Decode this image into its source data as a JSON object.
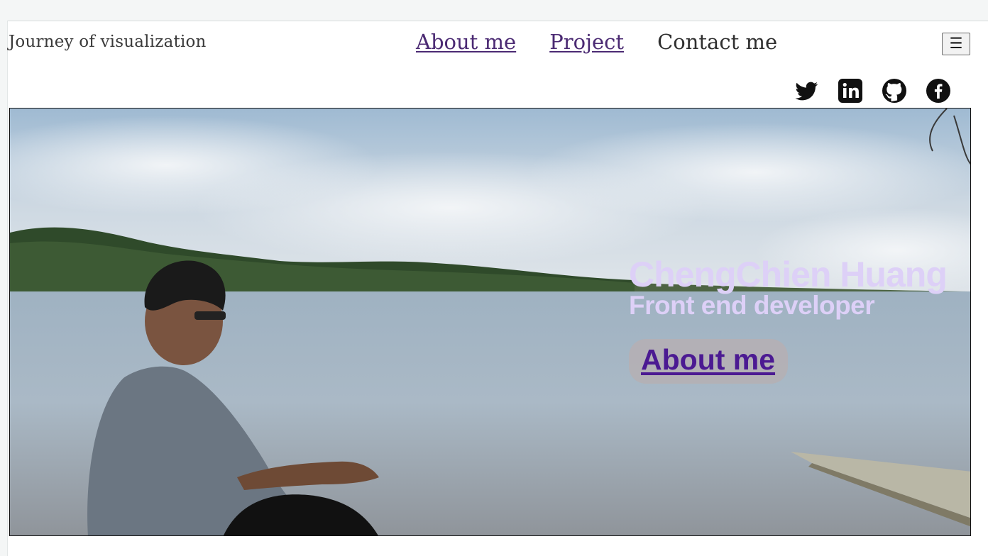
{
  "header": {
    "brand": "Journey of visualization",
    "nav": [
      {
        "label": "About me"
      },
      {
        "label": "Project"
      },
      {
        "label": "Contact me"
      }
    ],
    "menu_icon": "☰"
  },
  "socials": [
    {
      "icon": "twitter-icon"
    },
    {
      "icon": "linkedin-icon"
    },
    {
      "icon": "github-icon"
    },
    {
      "icon": "facebook-icon"
    }
  ],
  "hero": {
    "name": "ChengChien Huang",
    "role": "Front end developer",
    "button_label": "About me"
  },
  "colors": {
    "nav_link": "#4b2a73",
    "hero_text": "#ddd0f7",
    "hero_button_text": "#4b1a92"
  }
}
